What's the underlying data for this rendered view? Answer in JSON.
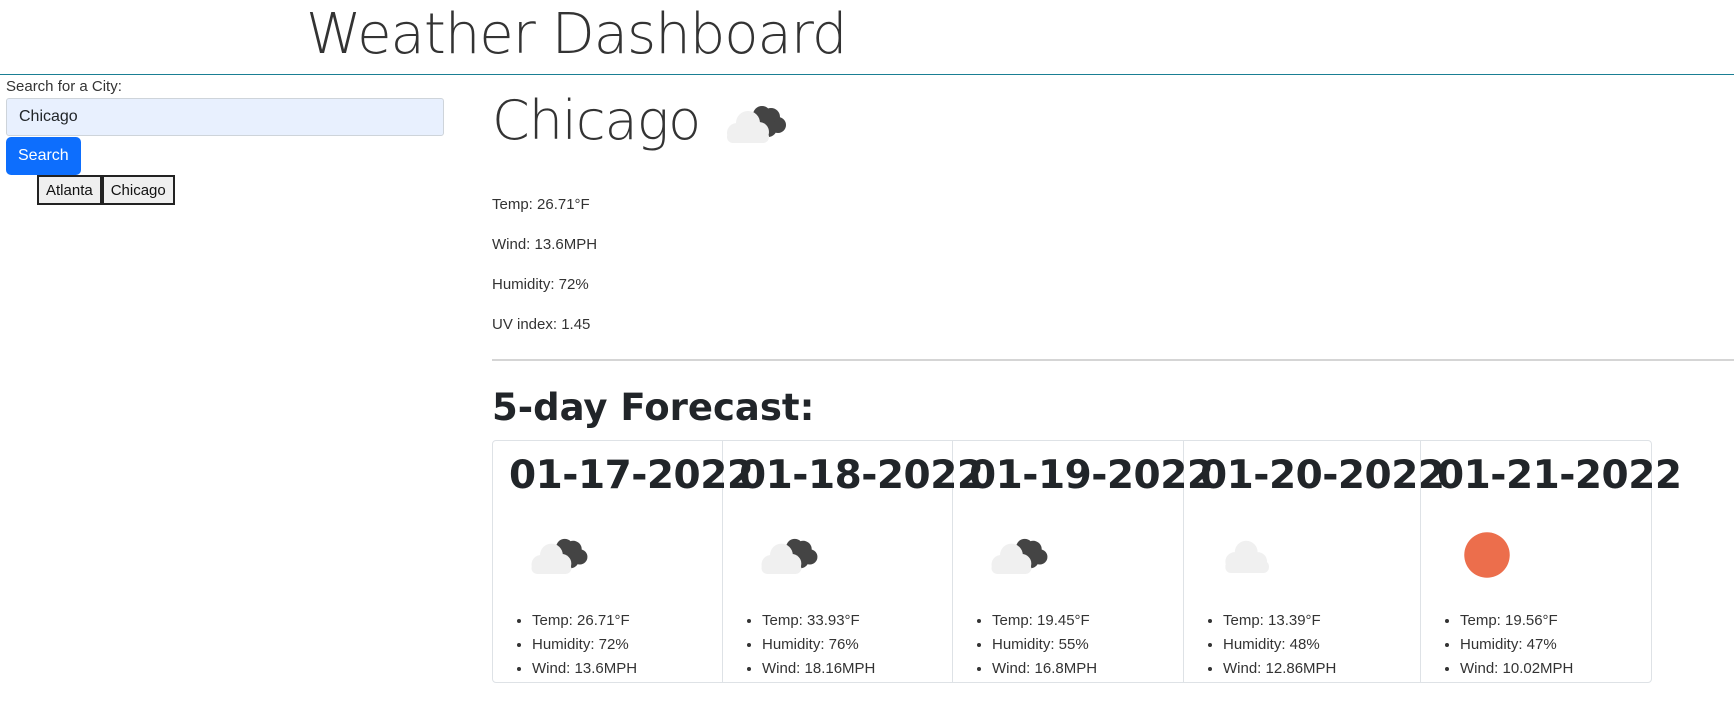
{
  "header": {
    "title": "Weather Dashboard"
  },
  "search": {
    "label": "Search for a City:",
    "value": "Chicago",
    "button_label": "Search",
    "history": [
      "Atlanta",
      "Chicago"
    ]
  },
  "current": {
    "city": "Chicago",
    "icon": "broken-clouds-icon",
    "temp": "Temp: 26.71°F",
    "wind": "Wind: 13.6MPH",
    "humidity": "Humidity: 72%",
    "uv": "UV index: 1.45"
  },
  "forecast": {
    "heading": "5-day Forecast:",
    "days": [
      {
        "date": "01-17-2022",
        "icon": "broken-clouds-icon",
        "temp": "Temp: 26.71°F",
        "humidity": "Humidity: 72%",
        "wind": "Wind: 13.6MPH"
      },
      {
        "date": "01-18-2022",
        "icon": "broken-clouds-icon",
        "temp": "Temp: 33.93°F",
        "humidity": "Humidity: 76%",
        "wind": "Wind: 18.16MPH"
      },
      {
        "date": "01-19-2022",
        "icon": "broken-clouds-icon",
        "temp": "Temp: 19.45°F",
        "humidity": "Humidity: 55%",
        "wind": "Wind: 16.8MPH"
      },
      {
        "date": "01-20-2022",
        "icon": "cloud-icon",
        "temp": "Temp: 13.39°F",
        "humidity": "Humidity: 48%",
        "wind": "Wind: 12.86MPH"
      },
      {
        "date": "01-21-2022",
        "icon": "sun-icon",
        "temp": "Temp: 19.56°F",
        "humidity": "Humidity: 47%",
        "wind": "Wind: 10.02MPH"
      }
    ]
  },
  "colors": {
    "search_button": "#0d6efd",
    "input_background": "#e8f0fe",
    "header_border": "#1a7f94",
    "sun": "#ec6e4c",
    "cloud_light": "#f0f0f0",
    "cloud_dark": "#444444"
  }
}
